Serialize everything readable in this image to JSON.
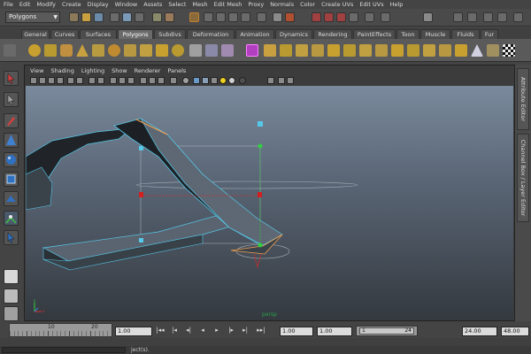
{
  "menubar": [
    "File",
    "Edit",
    "Modify",
    "Create",
    "Display",
    "Window",
    "Assets",
    "Select",
    "Mesh",
    "Edit Mesh",
    "Proxy",
    "Normals",
    "Color",
    "Create UVs",
    "Edit UVs",
    "Help"
  ],
  "statusline": {
    "mode": "Polygons"
  },
  "shelf": {
    "tabs": [
      "General",
      "Curves",
      "Surfaces",
      "Polygons",
      "Subdivs",
      "Deformation",
      "Animation",
      "Dynamics",
      "Rendering",
      "PaintEffects",
      "Toon",
      "Muscle",
      "Fluids",
      "Fur"
    ],
    "active": "Polygons"
  },
  "panel": {
    "menus": [
      "View",
      "Shading",
      "Lighting",
      "Show",
      "Renderer",
      "Panels"
    ],
    "camera_label": "persp"
  },
  "side_tabs": [
    "Attribute Editor",
    "Channel Box / Layer Editor"
  ],
  "time": {
    "ruler_ticks": [
      "10",
      "20"
    ],
    "current_time": "1.00",
    "start_time": "1.00",
    "playback_start": "1.00",
    "range_start": "1",
    "range_end": "24",
    "playback_end": "24.00",
    "end_time": "48.00"
  },
  "playback_buttons": [
    "|◂◂",
    "|◂",
    "◂|",
    "◂",
    "▸",
    "|▸",
    "▸|",
    "▸▸|"
  ],
  "command": {
    "help_text": "ject(s)."
  },
  "colors": {
    "viewport_top": "#7a8a9c",
    "viewport_bottom": "#34393f",
    "selection": "#56c8e8",
    "highlight": "#f0a050"
  }
}
